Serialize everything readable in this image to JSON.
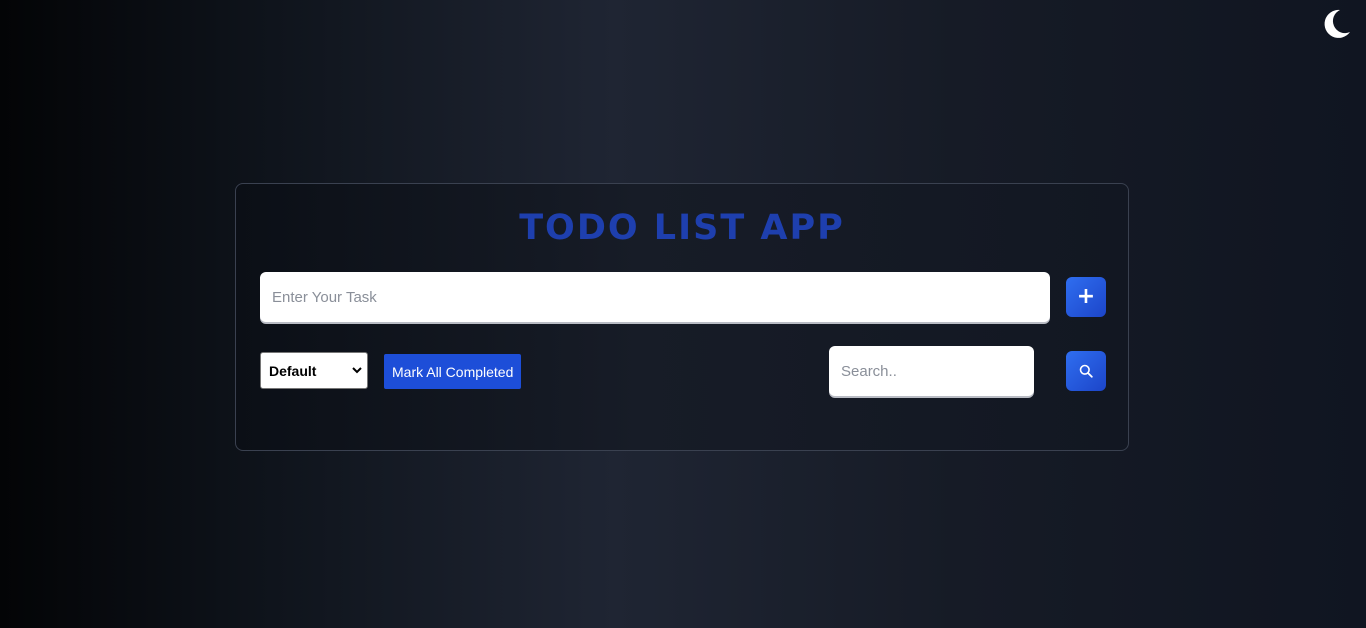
{
  "app": {
    "title": "TODO LIST APP"
  },
  "theme_toggle": {
    "icon": "moon-icon",
    "color": "#ffffff"
  },
  "task_form": {
    "input_placeholder": "Enter Your Task",
    "input_value": "",
    "add_button_icon": "plus-icon",
    "add_button_glyph": "+"
  },
  "controls": {
    "filter": {
      "selected": "Default",
      "options": [
        "Default"
      ]
    },
    "mark_all_label": "Mark All Completed",
    "search_placeholder": "Search..",
    "search_value": "",
    "search_button_icon": "search-icon"
  },
  "colors": {
    "accent": "#1d4ed8",
    "title": "#1e3fae",
    "button_gradient_start": "#2f6ef0",
    "button_gradient_end": "#1c45c9",
    "card_border": "#3a4150"
  }
}
